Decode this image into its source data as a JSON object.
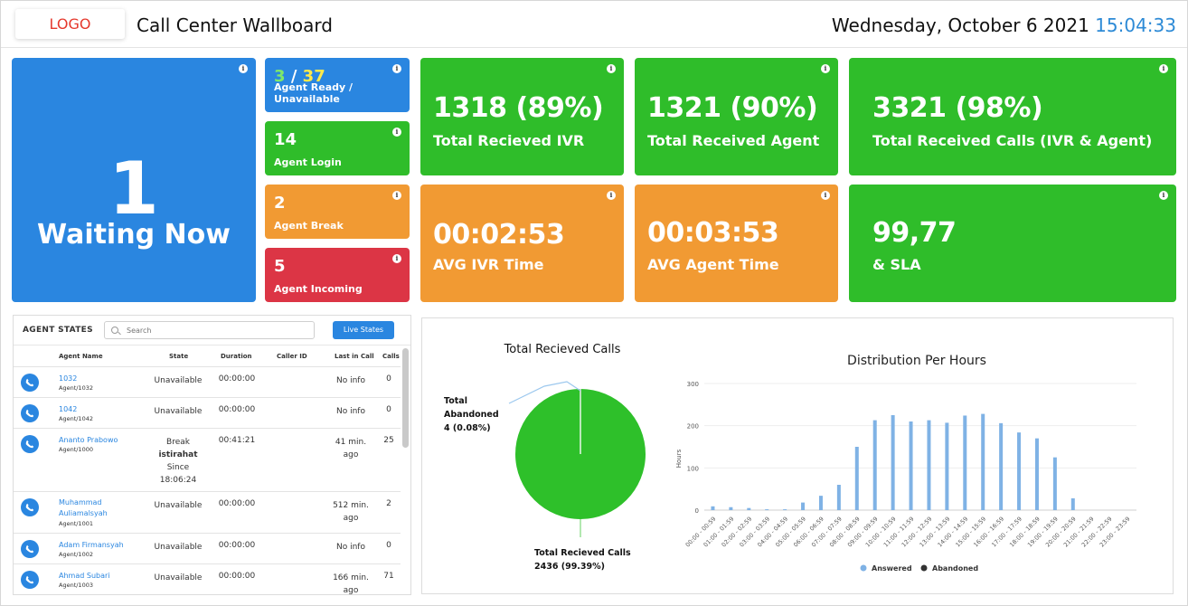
{
  "header": {
    "logo": "LOGO",
    "title": "Call Center Wallboard",
    "date": "Wednesday, October 6 2021",
    "time": "15:04:33"
  },
  "waiting": {
    "value": "1",
    "label": "Waiting Now"
  },
  "small_cards": [
    {
      "ready": "3",
      "slash": "/",
      "unavailable": "37",
      "label": "Agent Ready / Unavailable"
    },
    {
      "value": "14",
      "label": "Agent Login"
    },
    {
      "value": "2",
      "label": "Agent Break"
    },
    {
      "value": "5",
      "label": "Agent Incoming"
    }
  ],
  "kpis": [
    {
      "value": "1318 (89%)",
      "label": "Total Recieved IVR"
    },
    {
      "value": "1321 (90%)",
      "label": "Total Received Agent"
    },
    {
      "value": "3321 (98%)",
      "label": "Total Received Calls (IVR & Agent)"
    },
    {
      "value": "00:02:53",
      "label": "AVG IVR Time"
    },
    {
      "value": "00:03:53",
      "label": "AVG Agent Time"
    },
    {
      "value": "99,77",
      "label": "& SLA"
    }
  ],
  "info_icon": "i",
  "agent_states": {
    "title": "AGENT STATES",
    "search_placeholder": "Search",
    "live_button": "Live States",
    "columns": [
      "Agent Name",
      "State",
      "Duration",
      "Caller ID",
      "Last in Call",
      "Calls"
    ],
    "rows": [
      {
        "name": "1032",
        "id": "Agent/1032",
        "state": "Unavailable",
        "duration": "00:00:00",
        "caller_id": "",
        "last": "No info",
        "calls": "0"
      },
      {
        "name": "1042",
        "id": "Agent/1042",
        "state": "Unavailable",
        "duration": "00:00:00",
        "caller_id": "",
        "last": "No info",
        "calls": "0"
      },
      {
        "name": "Ananto Prabowo",
        "id": "Agent/1000",
        "state": "Break",
        "state_reason": "istirahat",
        "state_since": "Since",
        "state_time": "18:06:24",
        "duration": "00:41:21",
        "caller_id": "",
        "last": "41 min.",
        "last2": "ago",
        "calls": "25"
      },
      {
        "name": "Muhammad",
        "name2": "Auliamalsyah",
        "id": "Agent/1001",
        "state": "Unavailable",
        "duration": "00:00:00",
        "caller_id": "",
        "last": "512 min.",
        "last2": "ago",
        "calls": "2"
      },
      {
        "name": "Adam Firmansyah",
        "id": "Agent/1002",
        "state": "Unavailable",
        "duration": "00:00:00",
        "caller_id": "",
        "last": "No info",
        "calls": "0"
      },
      {
        "name": "Ahmad Subari",
        "id": "Agent/1003",
        "state": "Unavailable",
        "duration": "00:00:00",
        "caller_id": "",
        "last": "166 min.",
        "last2": "ago",
        "calls": "71"
      }
    ]
  },
  "colors": {
    "blue": "#2a86e0",
    "green": "#2fbd2a",
    "orange": "#f19a33",
    "red": "#dc3545",
    "answered": "#7fb2e5",
    "abandoned": "#333333",
    "pie_green": "#2ec02a"
  },
  "chart_data": [
    {
      "type": "pie",
      "title": "Total Recieved Calls",
      "slices": [
        {
          "label_line1": "Total",
          "label_line2": "Abandoned",
          "label_line3": "4 (0.08%)",
          "value": 4
        },
        {
          "label_line1": "Total Recieved Calls",
          "label_line2": "2436 (99.39%)",
          "value": 2436
        }
      ]
    },
    {
      "type": "bar",
      "title": "Distribution Per Hours",
      "ylabel": "Hours",
      "ylim": [
        0,
        300
      ],
      "yticks": [
        "0",
        "100",
        "200",
        "300"
      ],
      "categories": [
        "00:00 - 00:59",
        "01:00 - 01:59",
        "02:00 - 02:59",
        "03:00 - 03:59",
        "04:00 - 04:59",
        "05:00 - 05:59",
        "06:00 - 06:59",
        "07:00 - 07:59",
        "08:00 - 08:59",
        "09:00 - 09:59",
        "10:00 - 10:59",
        "11:00 - 11:59",
        "12:00 - 12:59",
        "13:00 - 13:59",
        "14:00 - 14:59",
        "15:00 - 15:59",
        "16:00 - 16:59",
        "17:00 - 17:59",
        "18:00 - 18:59",
        "19:00 - 19:59",
        "20:00 - 20:59",
        "21:00 - 21:59",
        "22:00 - 22:59",
        "23:00 - 23:59"
      ],
      "series": [
        {
          "name": "Answered",
          "values": [
            9,
            7,
            5,
            2,
            2,
            18,
            34,
            60,
            150,
            213,
            225,
            210,
            213,
            207,
            224,
            228,
            206,
            184,
            170,
            125,
            28,
            0,
            0,
            0
          ]
        },
        {
          "name": "Abandoned",
          "values": [
            0,
            0,
            0,
            0,
            0,
            0,
            0,
            0,
            0,
            0,
            0,
            0,
            0,
            0,
            0,
            0,
            0,
            0,
            0,
            0,
            0,
            0,
            0,
            0
          ]
        }
      ],
      "legend": "bottom"
    }
  ]
}
